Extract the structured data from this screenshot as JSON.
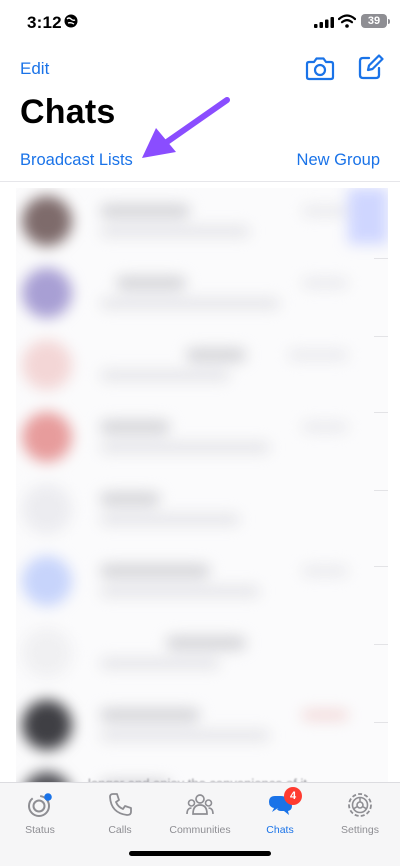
{
  "status_bar": {
    "time": "3:12",
    "battery": "39"
  },
  "header": {
    "edit_label": "Edit",
    "title": "Chats",
    "broadcast_label": "Broadcast Lists",
    "new_group_label": "New Group"
  },
  "chat_list": {
    "visible_snippet": "longer and enjoy the convenience of it..."
  },
  "tab_bar": {
    "tabs": [
      {
        "label": "Status",
        "icon": "status-icon"
      },
      {
        "label": "Calls",
        "icon": "phone-icon"
      },
      {
        "label": "Communities",
        "icon": "communities-icon"
      },
      {
        "label": "Chats",
        "icon": "chats-icon",
        "badge": "4",
        "active": true
      },
      {
        "label": "Settings",
        "icon": "gear-icon"
      }
    ]
  },
  "colors": {
    "accent": "#1a73e8",
    "annotation_arrow": "#8a4dff",
    "badge": "#ff3b30"
  }
}
